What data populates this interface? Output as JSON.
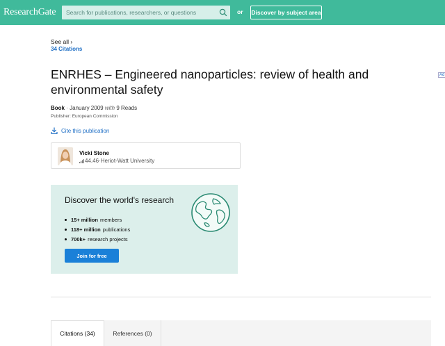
{
  "header": {
    "logo": "ResearchGate",
    "search_placeholder": "Search for publications, researchers, or questions",
    "or_label": "or",
    "discover_label": "Discover by subject area"
  },
  "citations_nav": {
    "see_all": "See all ›",
    "count": "34 Citations"
  },
  "publication": {
    "title": "ENRHES – Engineered nanoparticles: review of health and environmental safety",
    "type": "Book",
    "date": "January 2009",
    "with_label": "with",
    "reads": "9 Reads",
    "publisher": "Publisher: European Commission",
    "cite_label": "Cite this publication"
  },
  "author": {
    "name": "Vicki Stone",
    "score": "44.46",
    "affiliation": "Heriot-Watt University"
  },
  "discover_panel": {
    "title": "Discover the world's research",
    "items": [
      {
        "bold": "15+ million",
        "rest": "members"
      },
      {
        "bold": "118+ million",
        "rest": "publications"
      },
      {
        "bold": "700k+",
        "rest": "research projects"
      }
    ],
    "join_label": "Join for free"
  },
  "tabs": [
    {
      "label": "Citations (34)"
    },
    {
      "label": "References (0)"
    }
  ],
  "ad_label": "Ad",
  "colors": {
    "brand": "#40ba9b",
    "link": "#1f6fc5",
    "button": "#1a80d8",
    "panel_bg": "#dcefeb"
  }
}
